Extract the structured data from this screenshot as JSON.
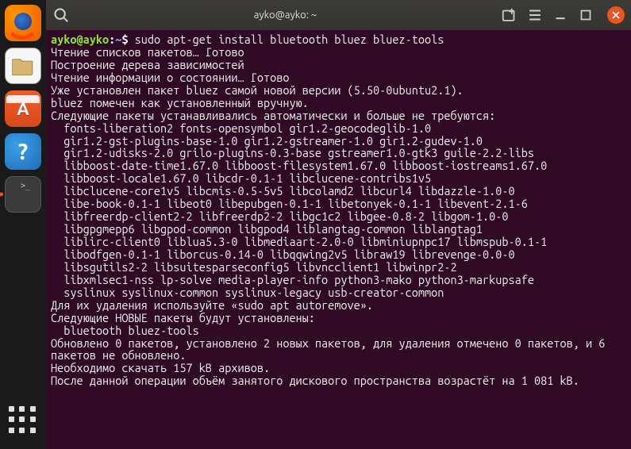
{
  "titlebar": {
    "title": "ayko@ayko: ~"
  },
  "prompt": {
    "user_host": "ayko@ayko",
    "path": "~",
    "symbol": "$",
    "command": "sudo apt-get install bluetooth bluez bluez-tools"
  },
  "lines": [
    "Чтение списков пакетов… Готово",
    "Построение дерева зависимостей",
    "Чтение информации о состоянии… Готово",
    "Уже установлен пакет bluez самой новой версии (5.50-0ubuntu2.1).",
    "bluez помечен как установленный вручную.",
    "Следующие пакеты устанавливались автоматически и больше не требуются:",
    "  fonts-liberation2 fonts-opensymbol gir1.2-geocodeglib-1.0",
    "  gir1.2-gst-plugins-base-1.0 gir1.2-gstreamer-1.0 gir1.2-gudev-1.0",
    "  gir1.2-udisks-2.0 grilo-plugins-0.3-base gstreamer1.0-gtk3 guile-2.2-libs",
    "  libboost-date-time1.67.0 libboost-filesystem1.67.0 libboost-iostreams1.67.0",
    "  libboost-locale1.67.0 libcdr-0.1-1 libclucene-contribs1v5",
    "  libclucene-core1v5 libcmis-0.5-5v5 libcolamd2 libcurl4 libdazzle-1.0-0",
    "  libe-book-0.1-1 libeot0 libepubgen-0.1-1 libetonyek-0.1-1 libevent-2.1-6",
    "  libfreerdp-client2-2 libfreerdp2-2 libgc1c2 libgee-0.8-2 libgom-1.0-0",
    "  libgpgmepp6 libgpod-common libgpod4 liblangtag-common liblangtag1",
    "  liblirc-client0 liblua5.3-0 libmediaart-2.0-0 libminiupnpc17 libmspub-0.1-1",
    "  libodfgen-0.1-1 liborcus-0.14-0 libqqwing2v5 libraw19 librevenge-0.0-0",
    "  libsgutils2-2 libsuitesparseconfig5 libvncclient1 libwinpr2-2",
    "  libxmlsec1-nss lp-solve media-player-info python3-mako python3-markupsafe",
    "  syslinux syslinux-common syslinux-legacy usb-creator-common",
    "Для их удаления используйте «sudo apt autoremove».",
    "Следующие НОВЫЕ пакеты будут установлены:",
    "  bluetooth bluez-tools",
    "Обновлено 0 пакетов, установлено 2 новых пакетов, для удаления отмечено 0 пакетов, и 6 пакетов не обновлено.",
    "Необходимо скачать 157 kB архивов.",
    "После данной операции объём занятого дискового пространства возрастёт на 1 081 kB."
  ],
  "launcher": {
    "apps": [
      "firefox",
      "files",
      "software",
      "help",
      "terminal"
    ]
  }
}
